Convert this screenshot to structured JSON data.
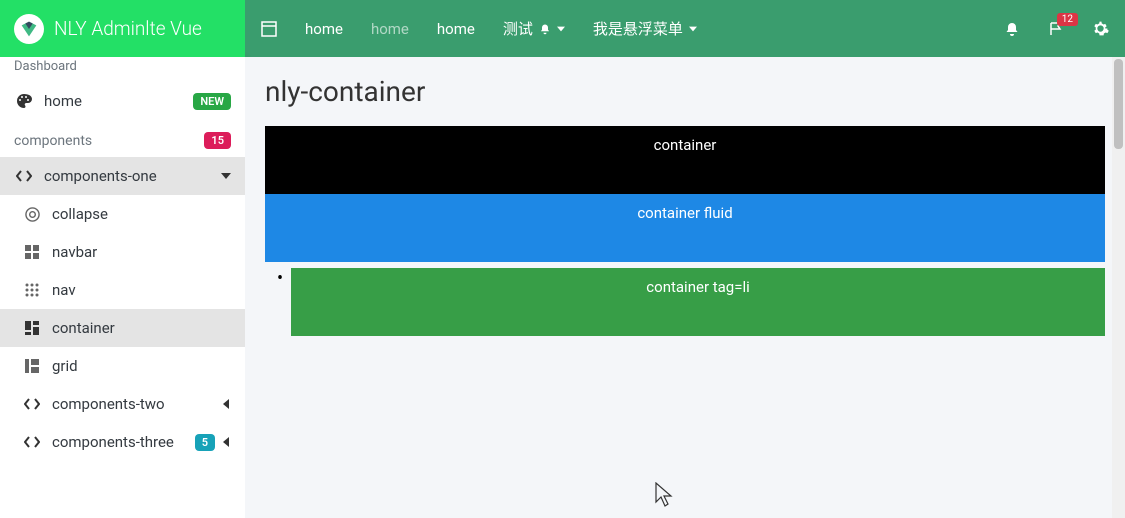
{
  "brand": {
    "title": "NLY Adminlte Vue"
  },
  "navbar": {
    "links": [
      {
        "label": "home",
        "muted": false
      },
      {
        "label": "home",
        "muted": true
      },
      {
        "label": "home",
        "muted": false
      },
      {
        "label": "测试",
        "muted": false,
        "bell": true
      },
      {
        "label": "我是悬浮菜单",
        "muted": false,
        "caret": true
      }
    ],
    "notif_count": "12"
  },
  "sidebar": {
    "header": "Dashboard",
    "home": {
      "label": "home",
      "badge": "NEW"
    },
    "section": {
      "label": "components",
      "badge": "15"
    },
    "items": [
      {
        "label": "components-one",
        "icon": "code",
        "active": true,
        "caret": "down"
      },
      {
        "label": "collapse",
        "icon": "chrome",
        "indent": true
      },
      {
        "label": "navbar",
        "icon": "grid",
        "indent": true
      },
      {
        "label": "nav",
        "icon": "dots",
        "indent": true
      },
      {
        "label": "container",
        "icon": "dashboard",
        "indent": true,
        "active": true
      },
      {
        "label": "grid",
        "icon": "grid2",
        "indent": true
      },
      {
        "label": "components-two",
        "icon": "code",
        "indent": true,
        "caret": "left"
      },
      {
        "label": "components-three",
        "icon": "code",
        "indent": true,
        "badge": "5",
        "caret": "left"
      }
    ]
  },
  "page": {
    "title": "nly-container",
    "demos": [
      {
        "label": "container",
        "cls": "demo-black"
      },
      {
        "label": "container fluid",
        "cls": "demo-blue"
      },
      {
        "label": "container tag=li",
        "cls": "demo-green",
        "bullet": true
      }
    ]
  }
}
